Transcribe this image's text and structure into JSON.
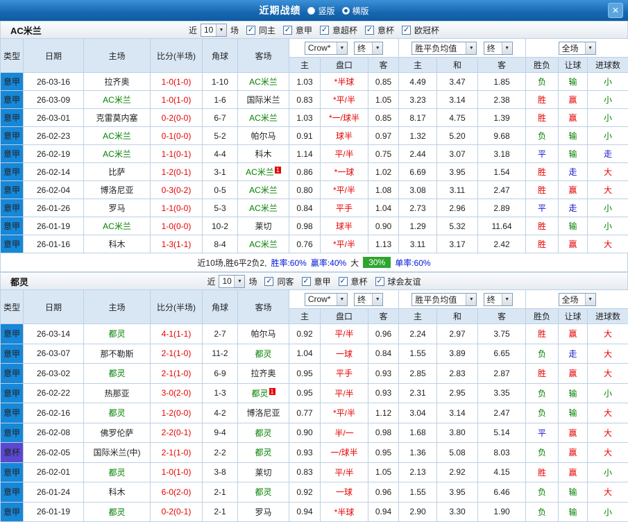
{
  "titlebar": {
    "title": "近期战绩",
    "options": [
      {
        "label": "竖版",
        "selected": false
      },
      {
        "label": "横版",
        "selected": true
      }
    ],
    "close_label": "✕"
  },
  "colors": {
    "win_red": "#e60000",
    "loss_green": "#008000",
    "draw_blue": "#1414cc",
    "league_blue": "#1787d8",
    "cup_purple": "#5b48d0",
    "focus_team_green": "#008000",
    "score_red": "#e60000",
    "handicap_red": "#e60000",
    "summary_blue": "#0016d9",
    "summary_green_bg": "#2da52d"
  },
  "table_headers": {
    "left": [
      "类型",
      "日期",
      "主场",
      "比分(半场)",
      "角球",
      "客场"
    ],
    "asian_sub": [
      "主",
      "盘口",
      "客"
    ],
    "europe_sub": [
      "主",
      "和",
      "客"
    ],
    "result_sub": [
      "胜负",
      "让球",
      "进球数"
    ]
  },
  "sections": [
    {
      "team": "AC米兰",
      "filter": {
        "near": "近",
        "games": "10",
        "suffix": "场",
        "checkboxes": [
          "同主",
          "意甲",
          "意超杯",
          "意杯",
          "欧冠杯"
        ]
      },
      "dropdowns": {
        "bookmaker": "Crow*",
        "final_a": "终",
        "avg": "胜平负均值",
        "final_b": "终",
        "scope": "全场"
      },
      "rows": [
        {
          "type": "意甲",
          "date": "26-03-16",
          "home": "拉齐奥",
          "home_focus": false,
          "score": "1-0(1-0)",
          "corners": "1-10",
          "away": "AC米兰",
          "away_focus": true,
          "asian": [
            "1.03",
            "*半球",
            "0.85"
          ],
          "europe": [
            "4.49",
            "3.47",
            "1.85"
          ],
          "results": [
            {
              "text": "负",
              "style": "loss"
            },
            {
              "text": "输",
              "style": "loss"
            },
            {
              "text": "小",
              "style": "loss"
            }
          ]
        },
        {
          "type": "意甲",
          "date": "26-03-09",
          "home": "AC米兰",
          "home_focus": true,
          "score": "1-0(1-0)",
          "corners": "1-6",
          "away": "国际米兰",
          "away_focus": false,
          "asian": [
            "0.83",
            "*平/半",
            "1.05"
          ],
          "europe": [
            "3.23",
            "3.14",
            "2.38"
          ],
          "results": [
            {
              "text": "胜",
              "style": "win"
            },
            {
              "text": "赢",
              "style": "win"
            },
            {
              "text": "小",
              "style": "loss"
            }
          ]
        },
        {
          "type": "意甲",
          "date": "26-03-01",
          "home": "克雷莫内塞",
          "home_focus": false,
          "score": "0-2(0-0)",
          "corners": "6-7",
          "away": "AC米兰",
          "away_focus": true,
          "asian": [
            "1.03",
            "*一/球半",
            "0.85"
          ],
          "europe": [
            "8.17",
            "4.75",
            "1.39"
          ],
          "results": [
            {
              "text": "胜",
              "style": "win"
            },
            {
              "text": "赢",
              "style": "win"
            },
            {
              "text": "小",
              "style": "loss"
            }
          ]
        },
        {
          "type": "意甲",
          "date": "26-02-23",
          "home": "AC米兰",
          "home_focus": true,
          "score": "0-1(0-0)",
          "corners": "5-2",
          "away": "帕尔马",
          "away_focus": false,
          "asian": [
            "0.91",
            "球半",
            "0.97"
          ],
          "europe": [
            "1.32",
            "5.20",
            "9.68"
          ],
          "results": [
            {
              "text": "负",
              "style": "loss"
            },
            {
              "text": "输",
              "style": "loss"
            },
            {
              "text": "小",
              "style": "loss"
            }
          ]
        },
        {
          "type": "意甲",
          "date": "26-02-19",
          "home": "AC米兰",
          "home_focus": true,
          "score": "1-1(0-1)",
          "corners": "4-4",
          "away": "科木",
          "away_focus": false,
          "asian": [
            "1.14",
            "平/半",
            "0.75"
          ],
          "europe": [
            "2.44",
            "3.07",
            "3.18"
          ],
          "results": [
            {
              "text": "平",
              "style": "draw"
            },
            {
              "text": "输",
              "style": "loss"
            },
            {
              "text": "走",
              "style": "draw"
            }
          ]
        },
        {
          "type": "意甲",
          "date": "26-02-14",
          "home": "比萨",
          "home_focus": false,
          "score": "1-2(0-1)",
          "corners": "3-1",
          "away": "AC米兰",
          "away_focus": true,
          "away_card": "1",
          "asian": [
            "0.86",
            "*一球",
            "1.02"
          ],
          "europe": [
            "6.69",
            "3.95",
            "1.54"
          ],
          "results": [
            {
              "text": "胜",
              "style": "win"
            },
            {
              "text": "走",
              "style": "draw"
            },
            {
              "text": "大",
              "style": "win"
            }
          ]
        },
        {
          "type": "意甲",
          "date": "26-02-04",
          "home": "博洛尼亚",
          "home_focus": false,
          "score": "0-3(0-2)",
          "corners": "0-5",
          "away": "AC米兰",
          "away_focus": true,
          "asian": [
            "0.80",
            "*平/半",
            "1.08"
          ],
          "europe": [
            "3.08",
            "3.11",
            "2.47"
          ],
          "results": [
            {
              "text": "胜",
              "style": "win"
            },
            {
              "text": "赢",
              "style": "win"
            },
            {
              "text": "大",
              "style": "win"
            }
          ]
        },
        {
          "type": "意甲",
          "date": "26-01-26",
          "home": "罗马",
          "home_focus": false,
          "score": "1-1(0-0)",
          "corners": "5-3",
          "away": "AC米兰",
          "away_focus": true,
          "asian": [
            "0.84",
            "平手",
            "1.04"
          ],
          "europe": [
            "2.73",
            "2.96",
            "2.89"
          ],
          "results": [
            {
              "text": "平",
              "style": "draw"
            },
            {
              "text": "走",
              "style": "draw"
            },
            {
              "text": "小",
              "style": "loss"
            }
          ]
        },
        {
          "type": "意甲",
          "date": "26-01-19",
          "home": "AC米兰",
          "home_focus": true,
          "score": "1-0(0-0)",
          "corners": "10-2",
          "away": "莱切",
          "away_focus": false,
          "asian": [
            "0.98",
            "球半",
            "0.90"
          ],
          "europe": [
            "1.29",
            "5.32",
            "11.64"
          ],
          "results": [
            {
              "text": "胜",
              "style": "win"
            },
            {
              "text": "输",
              "style": "loss"
            },
            {
              "text": "小",
              "style": "loss"
            }
          ]
        },
        {
          "type": "意甲",
          "date": "26-01-16",
          "home": "科木",
          "home_focus": false,
          "score": "1-3(1-1)",
          "corners": "8-4",
          "away": "AC米兰",
          "away_focus": true,
          "asian": [
            "0.76",
            "*平/半",
            "1.13"
          ],
          "europe": [
            "3.11",
            "3.17",
            "2.42"
          ],
          "results": [
            {
              "text": "胜",
              "style": "win"
            },
            {
              "text": "赢",
              "style": "win"
            },
            {
              "text": "大",
              "style": "win"
            }
          ]
        }
      ],
      "summary": [
        {
          "text": "近10场,胜6平2负2,",
          "style": "plain"
        },
        {
          "text": "胜率:60%",
          "style": "blue"
        },
        {
          "text": "赢率:40%",
          "style": "blue"
        },
        {
          "text": "大",
          "style": "plain"
        },
        {
          "text": "30%",
          "style": "greenbox"
        },
        {
          "text": "单率:60%",
          "style": "blue"
        }
      ]
    },
    {
      "team": "都灵",
      "filter": {
        "near": "近",
        "games": "10",
        "suffix": "场",
        "checkboxes": [
          "同客",
          "意甲",
          "意杯",
          "球会友谊"
        ]
      },
      "dropdowns": {
        "bookmaker": "Crow*",
        "final_a": "终",
        "avg": "胜平负均值",
        "final_b": "终",
        "scope": "全场"
      },
      "rows": [
        {
          "type": "意甲",
          "date": "26-03-14",
          "home": "都灵",
          "home_focus": true,
          "score": "4-1(1-1)",
          "corners": "2-7",
          "away": "帕尔马",
          "away_focus": false,
          "asian": [
            "0.92",
            "平/半",
            "0.96"
          ],
          "europe": [
            "2.24",
            "2.97",
            "3.75"
          ],
          "results": [
            {
              "text": "胜",
              "style": "win"
            },
            {
              "text": "赢",
              "style": "win"
            },
            {
              "text": "大",
              "style": "win"
            }
          ]
        },
        {
          "type": "意甲",
          "date": "26-03-07",
          "home": "那不勒斯",
          "home_focus": false,
          "score": "2-1(1-0)",
          "corners": "11-2",
          "away": "都灵",
          "away_focus": true,
          "asian": [
            "1.04",
            "一球",
            "0.84"
          ],
          "europe": [
            "1.55",
            "3.89",
            "6.65"
          ],
          "results": [
            {
              "text": "负",
              "style": "loss"
            },
            {
              "text": "走",
              "style": "draw"
            },
            {
              "text": "大",
              "style": "win"
            }
          ]
        },
        {
          "type": "意甲",
          "date": "26-03-02",
          "home": "都灵",
          "home_focus": true,
          "score": "2-1(1-0)",
          "corners": "6-9",
          "away": "拉齐奥",
          "away_focus": false,
          "asian": [
            "0.95",
            "平手",
            "0.93"
          ],
          "europe": [
            "2.85",
            "2.83",
            "2.87"
          ],
          "results": [
            {
              "text": "胜",
              "style": "win"
            },
            {
              "text": "赢",
              "style": "win"
            },
            {
              "text": "大",
              "style": "win"
            }
          ]
        },
        {
          "type": "意甲",
          "date": "26-02-22",
          "home": "热那亚",
          "home_focus": false,
          "score": "3-0(2-0)",
          "corners": "1-3",
          "away": "都灵",
          "away_focus": true,
          "away_card": "1",
          "asian": [
            "0.95",
            "平/半",
            "0.93"
          ],
          "europe": [
            "2.31",
            "2.95",
            "3.35"
          ],
          "results": [
            {
              "text": "负",
              "style": "loss"
            },
            {
              "text": "输",
              "style": "loss"
            },
            {
              "text": "小",
              "style": "loss"
            }
          ]
        },
        {
          "type": "意甲",
          "date": "26-02-16",
          "home": "都灵",
          "home_focus": true,
          "score": "1-2(0-0)",
          "corners": "4-2",
          "away": "博洛尼亚",
          "away_focus": false,
          "asian": [
            "0.77",
            "*平/半",
            "1.12"
          ],
          "europe": [
            "3.04",
            "3.14",
            "2.47"
          ],
          "results": [
            {
              "text": "负",
              "style": "loss"
            },
            {
              "text": "输",
              "style": "loss"
            },
            {
              "text": "大",
              "style": "win"
            }
          ]
        },
        {
          "type": "意甲",
          "date": "26-02-08",
          "home": "佛罗伦萨",
          "home_focus": false,
          "score": "2-2(0-1)",
          "corners": "9-4",
          "away": "都灵",
          "away_focus": true,
          "asian": [
            "0.90",
            "半/一",
            "0.98"
          ],
          "europe": [
            "1.68",
            "3.80",
            "5.14"
          ],
          "results": [
            {
              "text": "平",
              "style": "draw"
            },
            {
              "text": "赢",
              "style": "win"
            },
            {
              "text": "大",
              "style": "win"
            }
          ]
        },
        {
          "type": "意杯",
          "type_style": "cup",
          "date": "26-02-05",
          "home": "国际米兰(中)",
          "home_focus": false,
          "score": "2-1(1-0)",
          "corners": "2-2",
          "away": "都灵",
          "away_focus": true,
          "asian": [
            "0.93",
            "一/球半",
            "0.95"
          ],
          "europe": [
            "1.36",
            "5.08",
            "8.03"
          ],
          "results": [
            {
              "text": "负",
              "style": "loss"
            },
            {
              "text": "赢",
              "style": "win"
            },
            {
              "text": "大",
              "style": "win"
            }
          ]
        },
        {
          "type": "意甲",
          "date": "26-02-01",
          "home": "都灵",
          "home_focus": true,
          "score": "1-0(1-0)",
          "corners": "3-8",
          "away": "莱切",
          "away_focus": false,
          "asian": [
            "0.83",
            "平/半",
            "1.05"
          ],
          "europe": [
            "2.13",
            "2.92",
            "4.15"
          ],
          "results": [
            {
              "text": "胜",
              "style": "win"
            },
            {
              "text": "赢",
              "style": "win"
            },
            {
              "text": "小",
              "style": "loss"
            }
          ]
        },
        {
          "type": "意甲",
          "date": "26-01-24",
          "home": "科木",
          "home_focus": false,
          "score": "6-0(2-0)",
          "corners": "2-1",
          "away": "都灵",
          "away_focus": true,
          "asian": [
            "0.92",
            "一球",
            "0.96"
          ],
          "europe": [
            "1.55",
            "3.95",
            "6.46"
          ],
          "results": [
            {
              "text": "负",
              "style": "loss"
            },
            {
              "text": "输",
              "style": "loss"
            },
            {
              "text": "大",
              "style": "win"
            }
          ]
        },
        {
          "type": "意甲",
          "date": "26-01-19",
          "home": "都灵",
          "home_focus": true,
          "score": "0-2(0-1)",
          "corners": "2-1",
          "away": "罗马",
          "away_focus": false,
          "asian": [
            "0.94",
            "*半球",
            "0.94"
          ],
          "europe": [
            "2.90",
            "3.30",
            "1.90"
          ],
          "results": [
            {
              "text": "负",
              "style": "loss"
            },
            {
              "text": "输",
              "style": "loss"
            },
            {
              "text": "小",
              "style": "loss"
            }
          ]
        }
      ]
    }
  ]
}
